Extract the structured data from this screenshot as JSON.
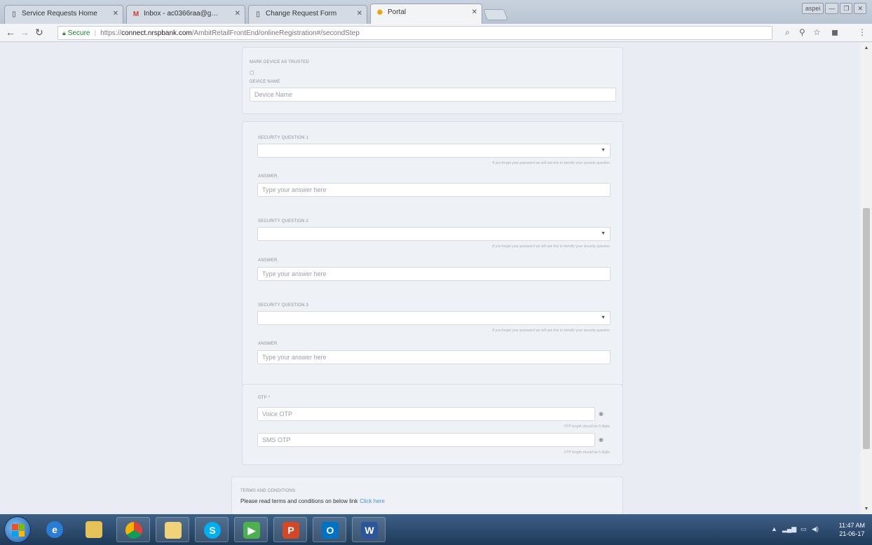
{
  "browser": {
    "tabs": [
      {
        "label": "Service Requests Home",
        "favicon": "document-icon"
      },
      {
        "label": "Inbox - ac0366raa@g…",
        "favicon": "gmail-icon"
      },
      {
        "label": "Change Request Form",
        "favicon": "document-icon"
      },
      {
        "label": "Portal",
        "favicon": "portal-icon"
      }
    ],
    "window_label": "aspei",
    "address": {
      "secure_label": "Secure",
      "scheme": "https://",
      "host": "connect.nrspbank.com",
      "path": "/AmbitRetailFrontEnd/onlineRegistration#/secondStep"
    }
  },
  "form": {
    "device": {
      "title": "MARK DEVICE AS TRUSTED",
      "checkbox_mark": "◻",
      "name_label": "DEVICE NAME",
      "name_placeholder": "Device Name"
    },
    "security_questions": [
      {
        "label": "SECURITY QUESTION 1",
        "hint": "If you forget your password we will ask this to identify your security question",
        "answer_label": "ANSWER",
        "answer_placeholder": "Type your answer here"
      },
      {
        "label": "SECURITY QUESTION 2",
        "hint": "If you forget your password we will ask this to identify your security question",
        "answer_label": "ANSWER",
        "answer_placeholder": "Type your answer here"
      },
      {
        "label": "SECURITY QUESTION 3",
        "hint": "If you forget your password we will ask this to identify your security question",
        "answer_label": "ANSWER",
        "answer_placeholder": "Type your answer here"
      }
    ],
    "otp": {
      "title": "OTP *",
      "voice_placeholder": "Voice OTP",
      "voice_hint": "OTP length should be 6 digits",
      "sms_placeholder": "SMS OTP",
      "sms_hint": "OTP length should be 6 digits"
    },
    "terms": {
      "title": "TERMS AND CONDITIONS",
      "text": "Please read terms and conditions on below link",
      "link": "Click here"
    }
  },
  "taskbar": {
    "clock_time": "11:47 AM",
    "clock_date": "21-06-17"
  }
}
